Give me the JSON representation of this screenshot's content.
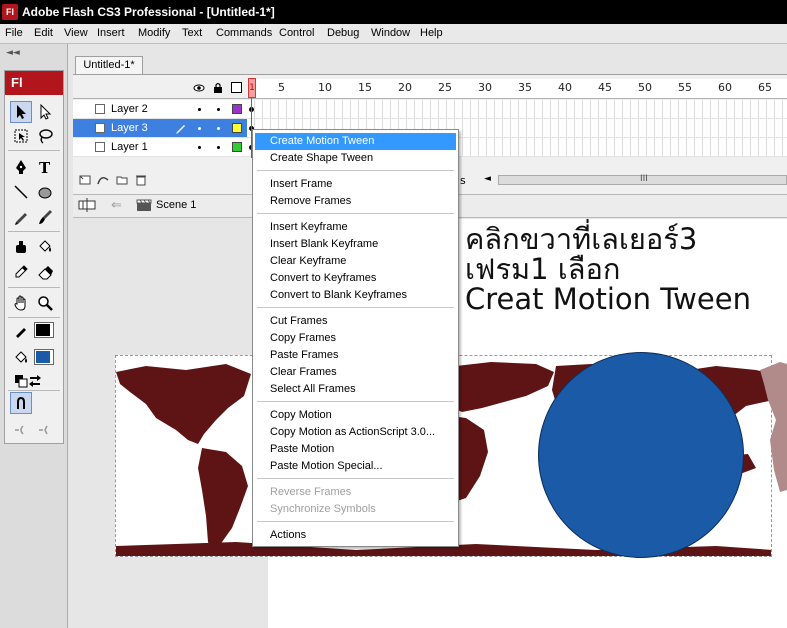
{
  "window": {
    "title": "Adobe Flash CS3 Professional - [Untitled-1*]",
    "logo": "Fl"
  },
  "menubar": [
    "File",
    "Edit",
    "View",
    "Insert",
    "Modify",
    "Text",
    "Commands",
    "Control",
    "Debug",
    "Window",
    "Help"
  ],
  "tools": {
    "header": "Fl",
    "collapse_glyph": "◄◄",
    "items": [
      "selection-tool",
      "subselection-tool",
      "free-transform-tool",
      "lasso-tool",
      "pen-tool",
      "text-tool",
      "line-tool",
      "oval-tool",
      "pencil-tool",
      "brush-tool",
      "ink-bottle-tool",
      "paint-bucket-tool",
      "eyedropper-tool",
      "eraser-tool",
      "hand-tool",
      "zoom-tool",
      "stroke-color",
      "fill-color",
      "black-white",
      "swap-colors",
      "snap-to-objects",
      "smooth",
      "straighten"
    ],
    "stroke_color": "#000000",
    "fill_color": "#1a5aa6"
  },
  "document": {
    "tab_label": "Untitled-1*"
  },
  "timeline": {
    "ruler": [
      "1",
      "5",
      "10",
      "15",
      "20",
      "25",
      "30",
      "35",
      "40",
      "45",
      "50",
      "55",
      "60",
      "65"
    ],
    "layers": [
      {
        "name": "Layer 2",
        "color": "#9933cc",
        "selected": false
      },
      {
        "name": "Layer 3",
        "color": "#ffff33",
        "selected": true
      },
      {
        "name": "Layer 1",
        "color": "#33cc33",
        "selected": false
      }
    ],
    "fps_fragment": "s"
  },
  "editbar": {
    "scene": "Scene 1"
  },
  "stage": {
    "instruction": "คลิกขวาที่เลเยอร์3\nเฟรม1 เลือก\nCreat Motion Tween",
    "map_color": "#5e1414",
    "circle_color": "#1a5aa6"
  },
  "context_menu": {
    "items": [
      {
        "label": "Create Motion Tween",
        "state": "highlighted"
      },
      {
        "label": "Create Shape Tween",
        "state": "normal"
      },
      {
        "label": "Insert Frame",
        "state": "normal"
      },
      {
        "label": "Remove Frames",
        "state": "normal"
      },
      {
        "label": "Insert Keyframe",
        "state": "normal"
      },
      {
        "label": "Insert Blank Keyframe",
        "state": "normal"
      },
      {
        "label": "Clear Keyframe",
        "state": "normal"
      },
      {
        "label": "Convert to Keyframes",
        "state": "normal"
      },
      {
        "label": "Convert to Blank Keyframes",
        "state": "normal"
      },
      {
        "label": "Cut Frames",
        "state": "normal"
      },
      {
        "label": "Copy Frames",
        "state": "normal"
      },
      {
        "label": "Paste Frames",
        "state": "normal"
      },
      {
        "label": "Clear Frames",
        "state": "normal"
      },
      {
        "label": "Select All Frames",
        "state": "normal"
      },
      {
        "label": "Copy Motion",
        "state": "normal"
      },
      {
        "label": "Copy Motion as ActionScript 3.0...",
        "state": "normal"
      },
      {
        "label": "Paste Motion",
        "state": "normal"
      },
      {
        "label": "Paste Motion Special...",
        "state": "normal"
      },
      {
        "label": "Reverse Frames",
        "state": "disabled"
      },
      {
        "label": "Synchronize Symbols",
        "state": "disabled"
      },
      {
        "label": "Actions",
        "state": "normal"
      }
    ]
  }
}
